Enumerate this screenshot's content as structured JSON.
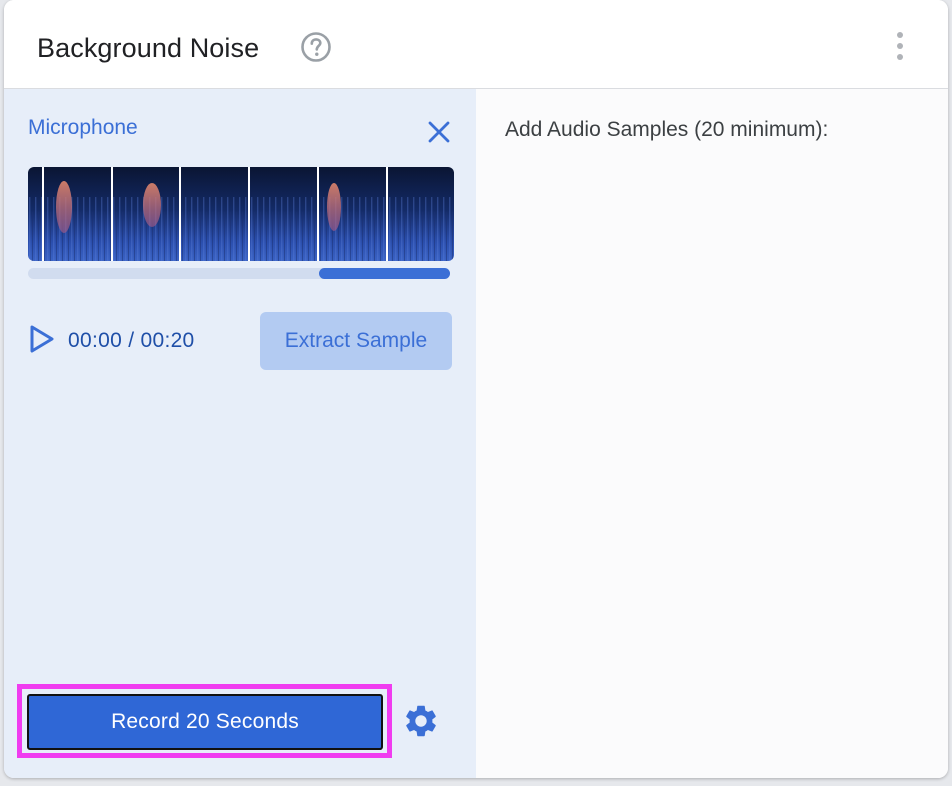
{
  "card": {
    "title": "Background Noise",
    "help_icon": "help-circle-icon",
    "more_icon": "more-vertical-icon"
  },
  "recorder": {
    "source_label": "Microphone",
    "close_icon": "close-icon",
    "playback": {
      "current_time": "00:00",
      "separator": "/",
      "total_time": "00:20",
      "play_icon": "play-icon"
    },
    "extract_button": "Extract Sample",
    "record_button": "Record 20 Seconds",
    "settings_icon": "gear-icon",
    "scroll_position": {
      "start_fraction": 0.69,
      "end_fraction": 1.0
    }
  },
  "samples": {
    "label": "Add Audio Samples (20 minimum):"
  },
  "colors": {
    "accent": "#3b6fd6",
    "record_button": "#2f67d6",
    "highlight": "#f03cf0",
    "left_panel_bg": "#e7eef9",
    "extract_button_bg": "#b3cbf2"
  }
}
